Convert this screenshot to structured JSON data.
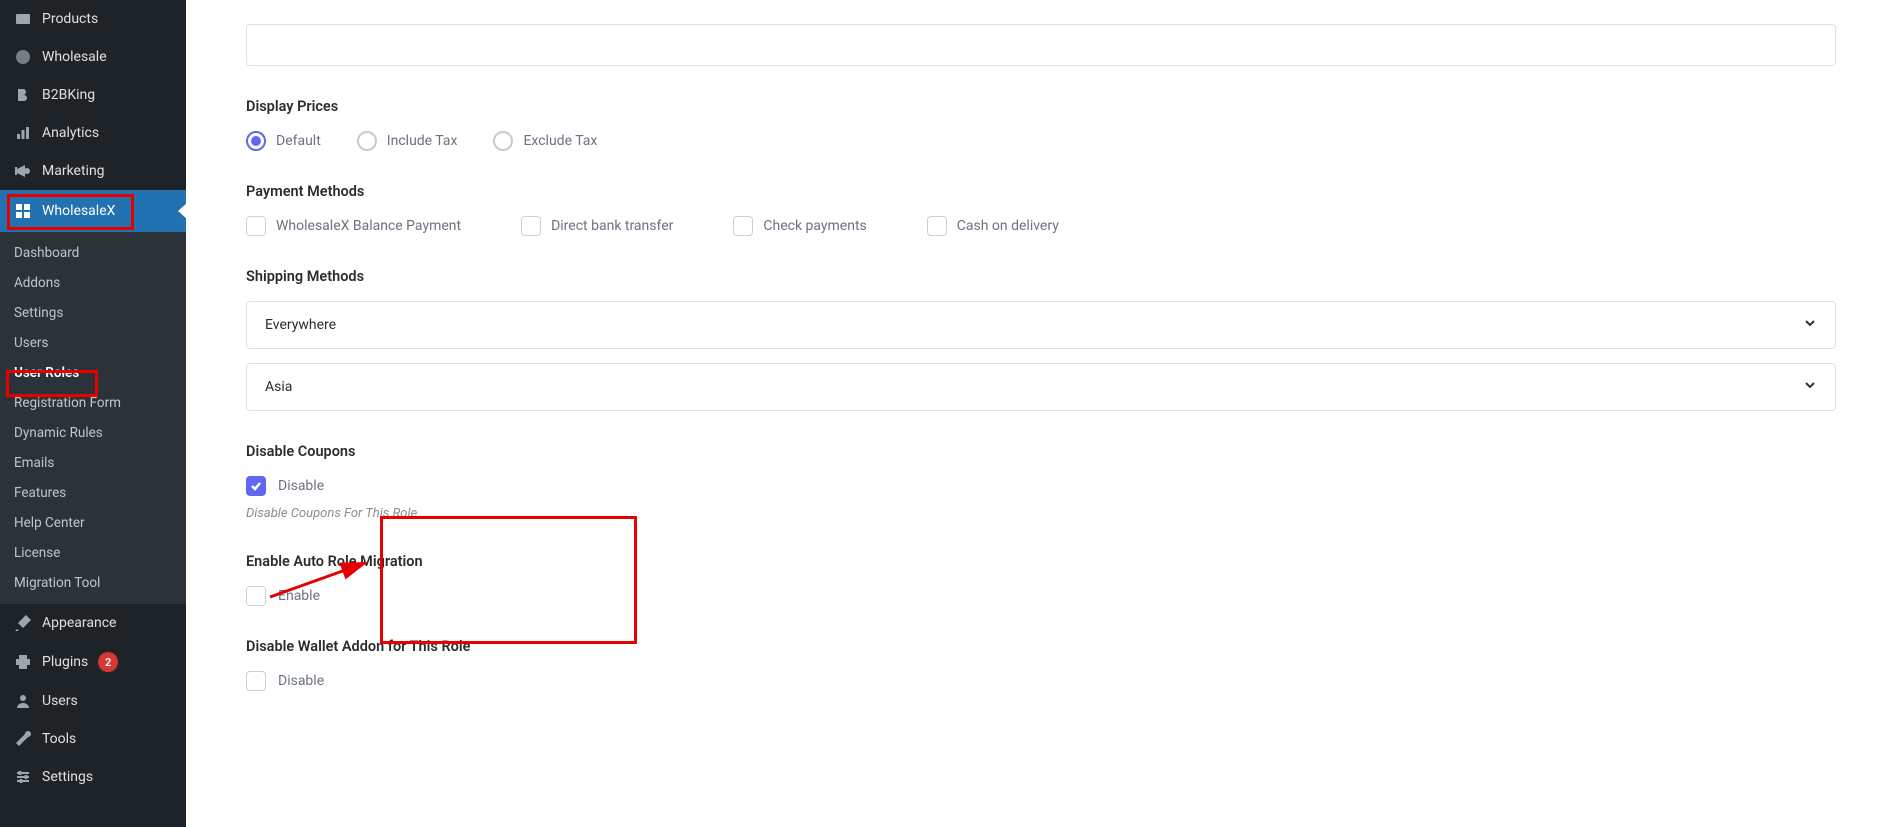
{
  "sidebar": {
    "products": "Products",
    "wholesale": "Wholesale",
    "b2bking": "B2BKing",
    "analytics": "Analytics",
    "marketing": "Marketing",
    "wholesalex": "WholesaleX",
    "sub": {
      "dashboard": "Dashboard",
      "addons": "Addons",
      "settings": "Settings",
      "users": "Users",
      "user_roles": "User Roles",
      "registration_form": "Registration Form",
      "dynamic_rules": "Dynamic Rules",
      "emails": "Emails",
      "features": "Features",
      "help_center": "Help Center",
      "license": "License",
      "migration_tool": "Migration Tool"
    },
    "appearance": "Appearance",
    "plugins": "Plugins",
    "plugins_badge": "2",
    "users2": "Users",
    "tools": "Tools",
    "settings2": "Settings"
  },
  "form": {
    "display_prices": {
      "title": "Display Prices",
      "default": "Default",
      "include": "Include Tax",
      "exclude": "Exclude Tax"
    },
    "payment_methods": {
      "title": "Payment Methods",
      "balance": "WholesaleX Balance Payment",
      "bank": "Direct bank transfer",
      "check": "Check payments",
      "cod": "Cash on delivery"
    },
    "shipping": {
      "title": "Shipping Methods",
      "opt1": "Everywhere",
      "opt2": "Asia"
    },
    "disable_coupons": {
      "title": "Disable Coupons",
      "label": "Disable",
      "note": "Disable Coupons For This Role"
    },
    "auto_role": {
      "title": "Enable Auto Role Migration",
      "label": "Enable"
    },
    "disable_wallet": {
      "title": "Disable Wallet Addon for This Role",
      "label": "Disable"
    }
  }
}
